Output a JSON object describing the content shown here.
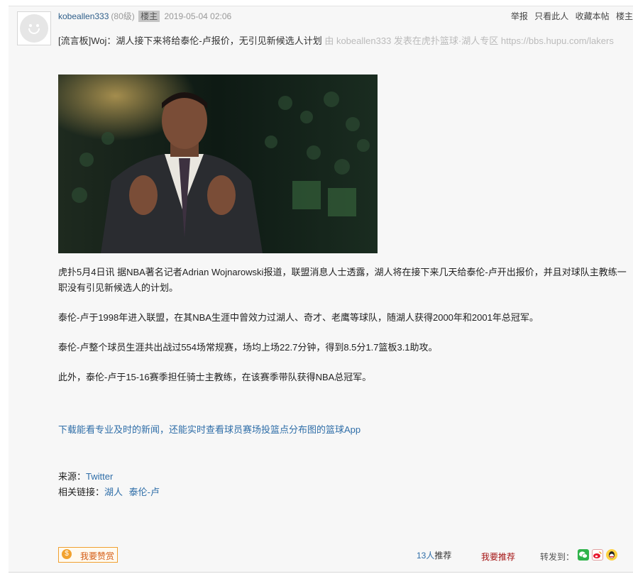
{
  "post": {
    "username": "kobeallen333",
    "level": "(80级)",
    "op_badge": "楼主",
    "time": "2019-05-04 02:06",
    "actions": [
      "举报",
      "只看此人",
      "收藏本帖",
      "楼主"
    ],
    "title": "[流言板]Woj：湖人接下来将给泰伦-卢报价，无引见新候选人计划",
    "source_note": "由 kobeallen333 发表在虎扑篮球·湖人专区 https://bbs.hupu.com/lakers",
    "paragraphs": [
      "虎扑5月4日讯 据NBA著名记者Adrian Wojnarowski报道，联盟消息人士透露，湖人将在接下来几天给泰伦-卢开出报价，并且对球队主教练一职没有引见新候选人的计划。",
      "泰伦-卢于1998年进入联盟，在其NBA生涯中曾效力过湖人、奇才、老鹰等球队，随湖人获得2000年和2001年总冠军。",
      "泰伦-卢整个球员生涯共出战过554场常规赛，场均上场22.7分钟，得到8.5分1.7篮板3.1助攻。",
      "此外，泰伦-卢于15-16赛季担任骑士主教练，在该赛季带队获得NBA总冠军。"
    ],
    "app_link": "下载能看专业及时的新闻，还能实时查看球员赛场投篮点分布图的篮球App",
    "source_label": "来源：",
    "source_value": "Twitter",
    "related_label": "相关链接：",
    "related_links": [
      "湖人",
      "泰伦-卢"
    ]
  },
  "footer": {
    "reward_icon": "$",
    "reward_label": "我要赞赏",
    "recommend_count": "13人",
    "recommend_suffix": "推荐",
    "recommend_button": "我要推荐",
    "share_label": "转发到：",
    "share_icons": [
      "wechat-icon",
      "weibo-icon",
      "qq-icon"
    ]
  },
  "colors": {
    "link": "#2f6ea8",
    "source_gray": "#bbbbbb",
    "recommend_red": "#a41313",
    "reward_orange": "#f2a22e"
  }
}
